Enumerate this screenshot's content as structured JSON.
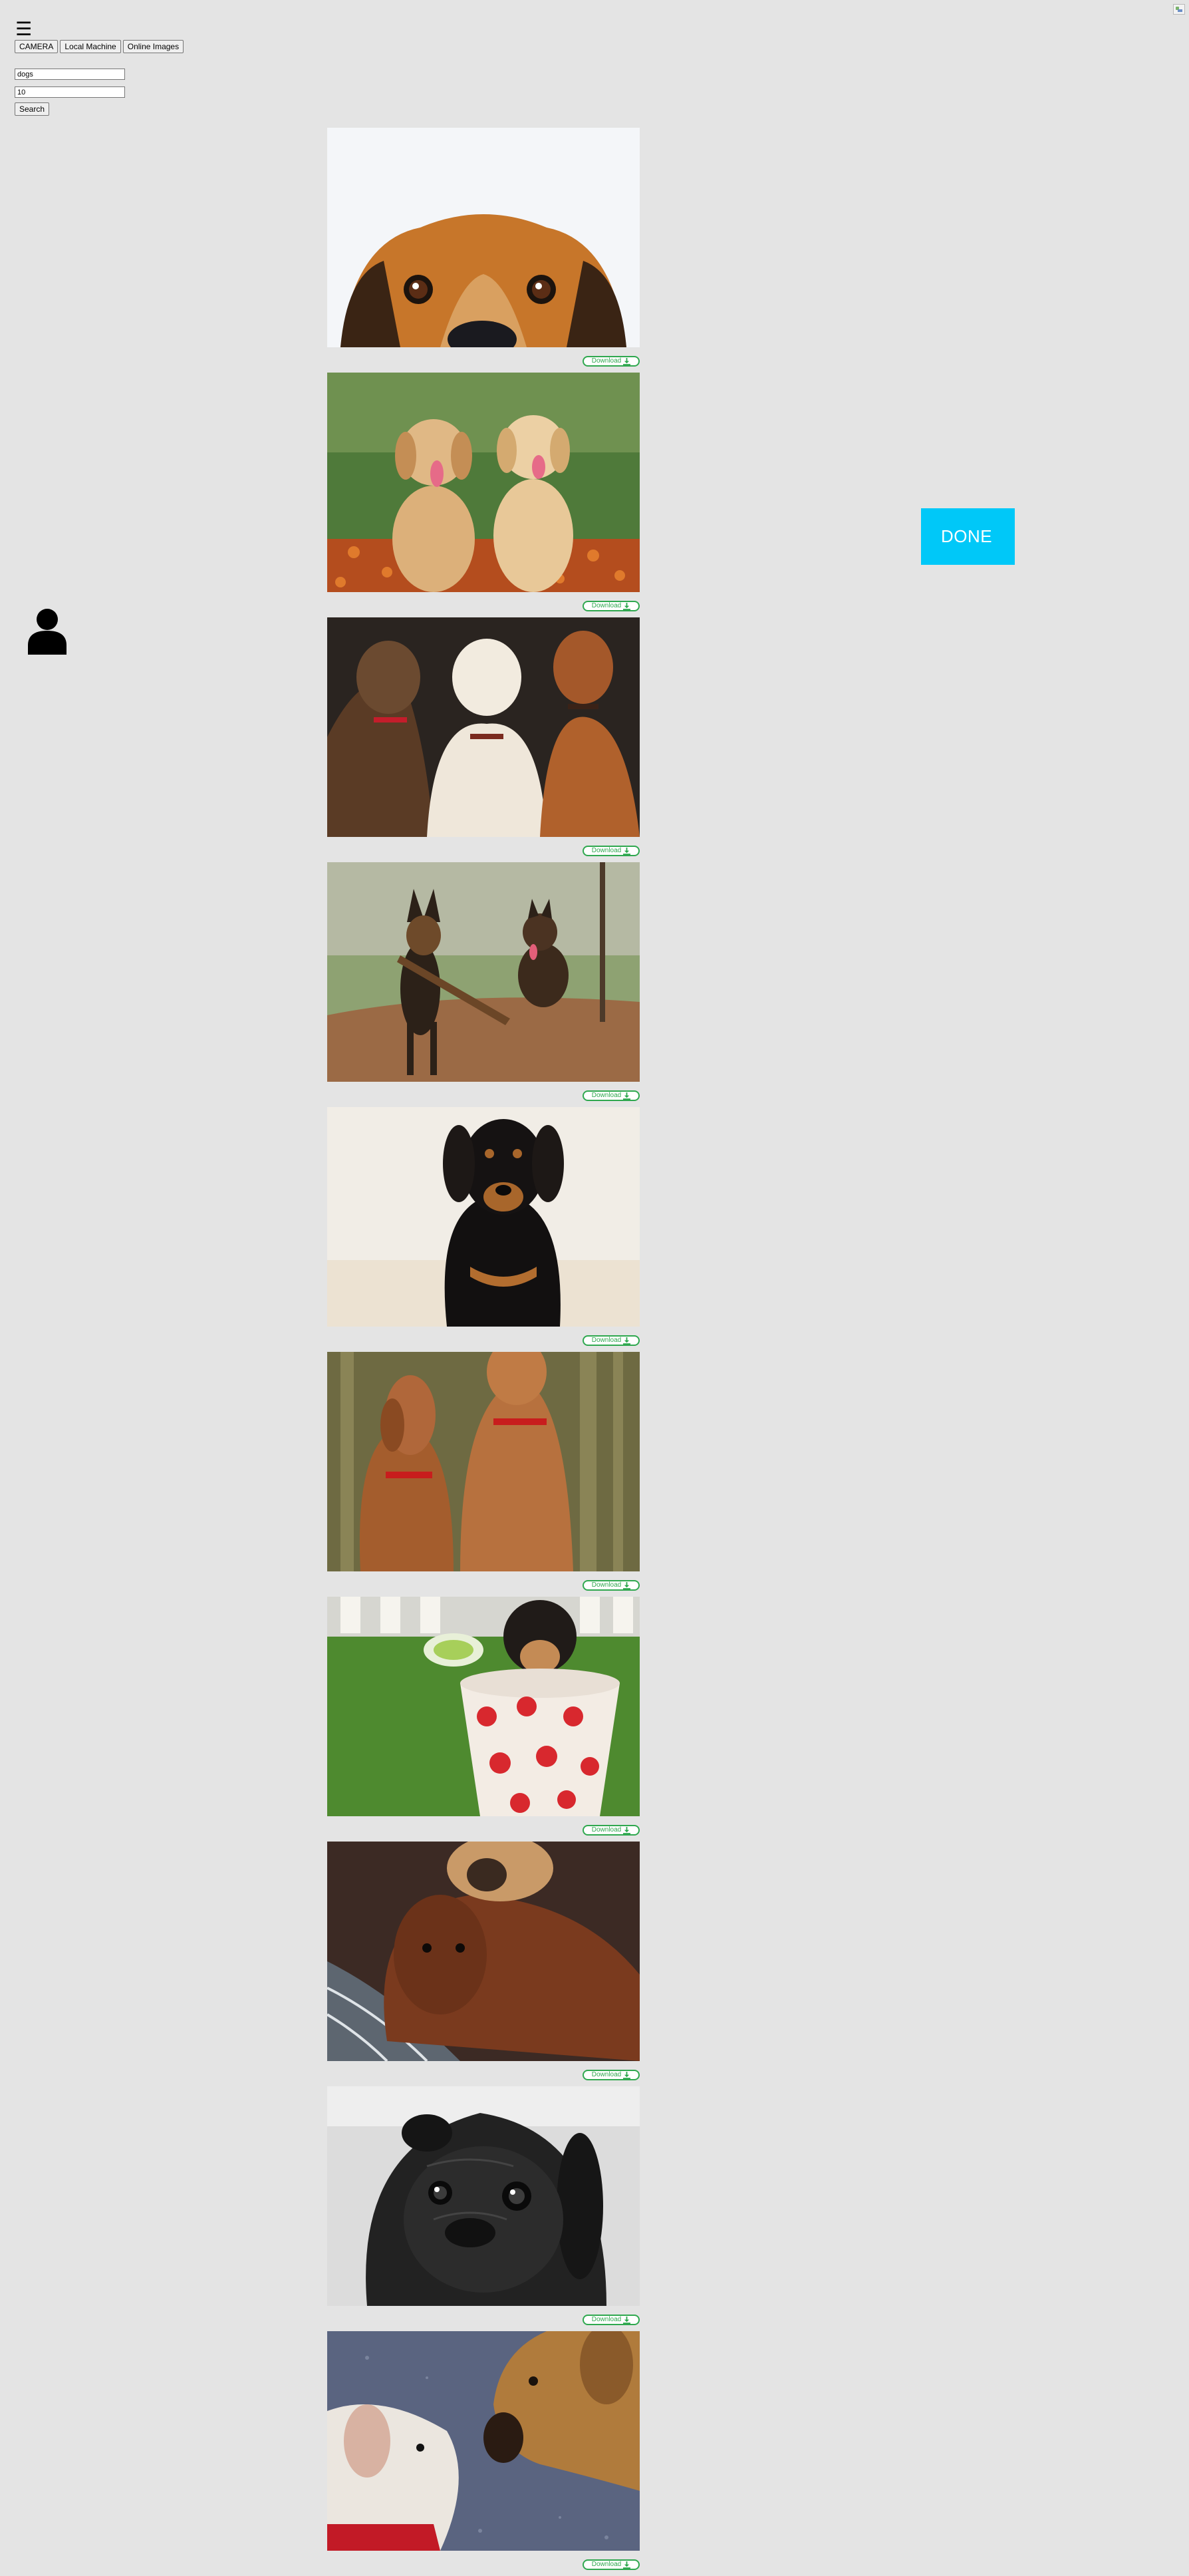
{
  "header": {
    "menu_icon": "☰",
    "broken_image_alt": ""
  },
  "sources": {
    "buttons": [
      "CAMERA",
      "Local Machine",
      "Online Images"
    ]
  },
  "search": {
    "query_value": "dogs",
    "count_value": "10",
    "button_label": "Search"
  },
  "done_button": {
    "label": "DONE",
    "color": "#00c8f8"
  },
  "download": {
    "label": "Download",
    "icon": "download-icon",
    "color": "#2fa84f"
  },
  "gallery": {
    "images": [
      {
        "name": "dog-peeking-photo",
        "alt": ""
      },
      {
        "name": "golden-retriever-puppies-photo",
        "alt": ""
      },
      {
        "name": "three-boxer-dogs-photo",
        "alt": ""
      },
      {
        "name": "german-shepherds-stick-photo",
        "alt": ""
      },
      {
        "name": "rottweiler-puppy-photo",
        "alt": ""
      },
      {
        "name": "vizsla-dogs-photo",
        "alt": ""
      },
      {
        "name": "puppy-in-polka-dot-cup-photo",
        "alt": ""
      },
      {
        "name": "spaniel-and-pug-photo",
        "alt": ""
      },
      {
        "name": "black-pug-photo",
        "alt": ""
      },
      {
        "name": "two-dogs-nuzzling-photo",
        "alt": ""
      }
    ]
  }
}
